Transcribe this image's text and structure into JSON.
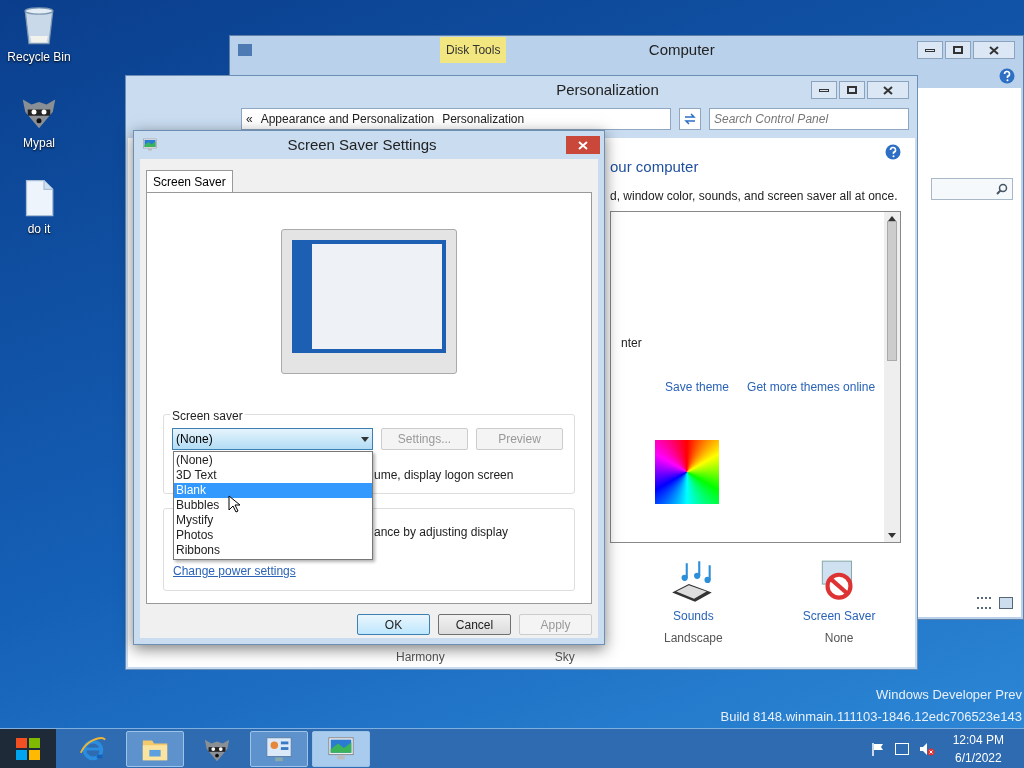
{
  "desktop_icons": [
    {
      "kind": "bin",
      "label": "Recycle Bin"
    },
    {
      "kind": "raccoon",
      "label": "Mypal"
    },
    {
      "kind": "file",
      "label": "do it"
    }
  ],
  "computer_window": {
    "title": "Computer",
    "context_tab": "Disk Tools"
  },
  "personalization_window": {
    "title": "Personalization",
    "breadcrumb": [
      "«",
      "Appearance and Personalization",
      "Personalization"
    ],
    "search": {
      "placeholder": "Search Control Panel"
    },
    "heading": "our computer",
    "description": "d, window color, sounds, and screen saver all at once.",
    "theme_fragment": "nter",
    "links": [
      "Save theme",
      "Get more themes online"
    ],
    "bottom_items": [
      {
        "kind": "sounds",
        "label": "Sounds",
        "value": "Landscape"
      },
      {
        "kind": "screensaver",
        "label": "Screen Saver",
        "value": "None"
      }
    ],
    "hidden_labels": [
      "Harmony",
      "Sky"
    ]
  },
  "dialog": {
    "title": "Screen Saver Settings",
    "tab": "Screen Saver",
    "group_label": "Screen saver",
    "combo_value": "(None)",
    "buttons": [
      {
        "label": "Settings...",
        "disabled": true
      },
      {
        "label": "Preview",
        "disabled": true
      }
    ],
    "dropdown": [
      {
        "label": "(None)",
        "selected": false
      },
      {
        "label": "3D Text",
        "selected": false
      },
      {
        "label": "Blank",
        "selected": true
      },
      {
        "label": "Bubbles",
        "selected": false
      },
      {
        "label": "Mystify",
        "selected": false
      },
      {
        "label": "Photos",
        "selected": false
      },
      {
        "label": "Ribbons",
        "selected": false
      }
    ],
    "option_fragment": "ume, display logon screen",
    "power_fragment": "ance by adjusting display",
    "power_link": "Change power settings",
    "footer_buttons": [
      {
        "label": "OK",
        "disabled": false,
        "default": true
      },
      {
        "label": "Cancel",
        "disabled": false,
        "default": false
      },
      {
        "label": "Apply",
        "disabled": true,
        "default": false
      }
    ]
  },
  "desktop_text": [
    "Windows Developer Prev",
    "Build 8148.winmain.111103-1846.12edc706523e143"
  ],
  "taskbar": {
    "buttons": [
      {
        "kind": "ie",
        "running": false,
        "selected": false
      },
      {
        "kind": "explorer",
        "running": true,
        "selected": false
      },
      {
        "kind": "raccoon",
        "running": false,
        "selected": false
      },
      {
        "kind": "controlpanel",
        "running": true,
        "selected": false
      },
      {
        "kind": "personalization",
        "running": true,
        "selected": true
      }
    ],
    "clock": {
      "time": "12:04 PM",
      "date": "6/1/2022"
    }
  }
}
